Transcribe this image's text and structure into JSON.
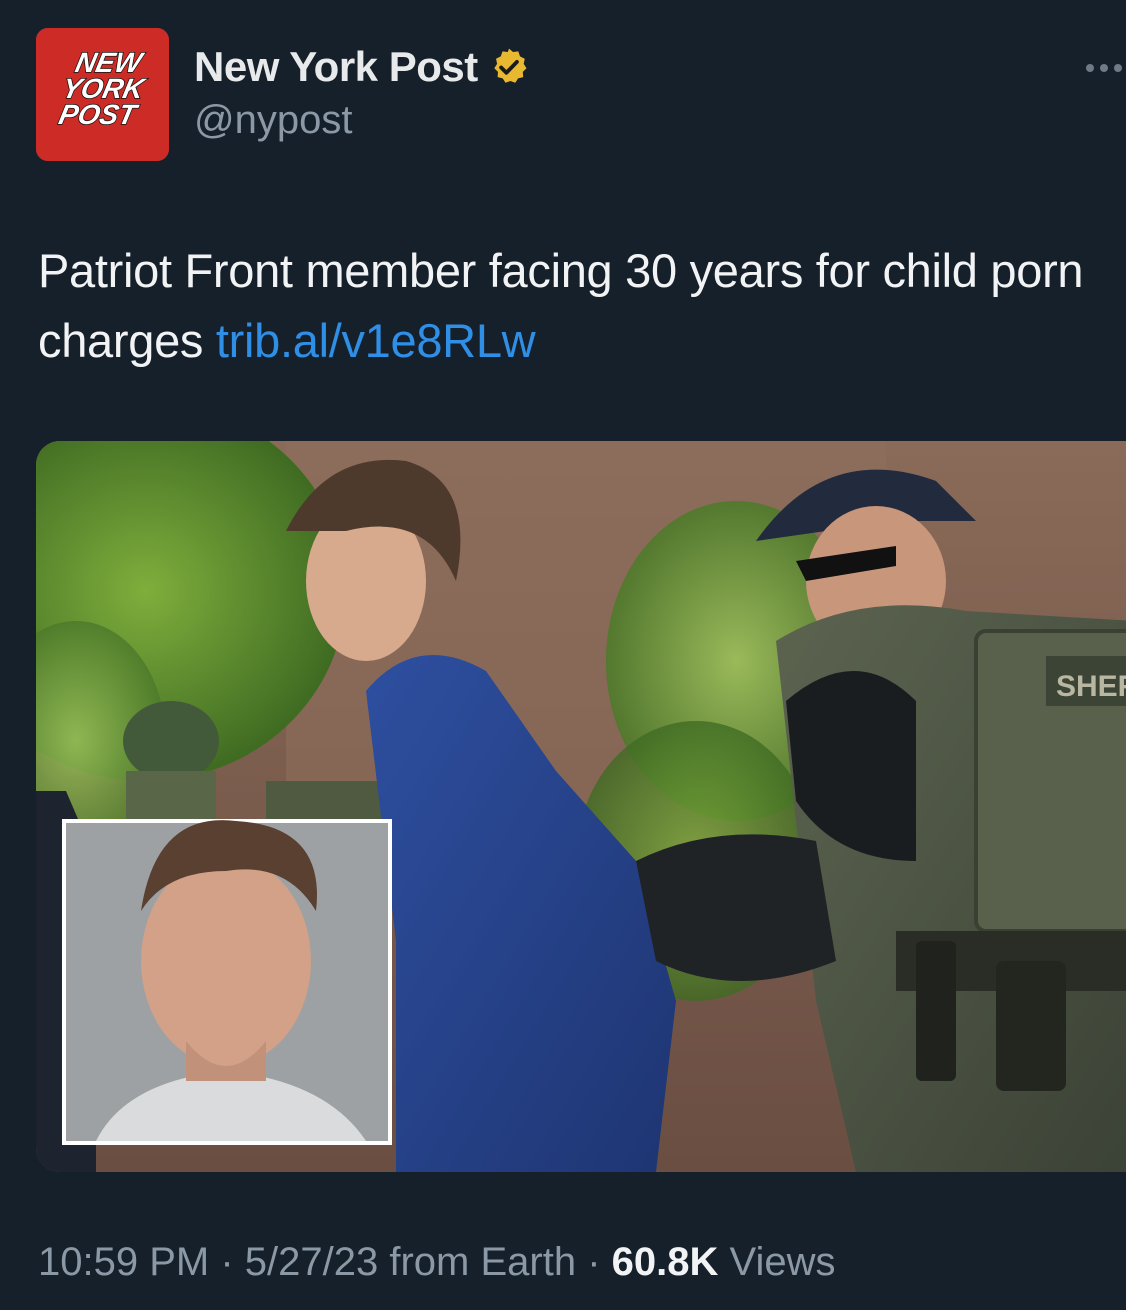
{
  "account": {
    "display_name": "New York Post",
    "handle": "@nypost",
    "avatar_lines": [
      "NEW",
      "YORK",
      "POST"
    ]
  },
  "tweet": {
    "text": "Patriot Front member facing 30 years for child porn charges ",
    "link": "trib.al/v1e8RLw"
  },
  "media": {
    "badge_text": "SHER"
  },
  "meta": {
    "time": "10:59 PM",
    "sep1": " · ",
    "date": "5/27/23",
    "source": " from Earth",
    "sep2": " · ",
    "views_count": "60.8K",
    "views_label": " Views"
  },
  "colors": {
    "background": "#16202b",
    "brand_red": "#cc2b26",
    "link": "#2f8fe6",
    "verified_gold": "#e8b830",
    "secondary_text": "#8b98a5"
  },
  "icons": {
    "verified": "verified-badge-icon",
    "more": "more-dots-icon"
  }
}
